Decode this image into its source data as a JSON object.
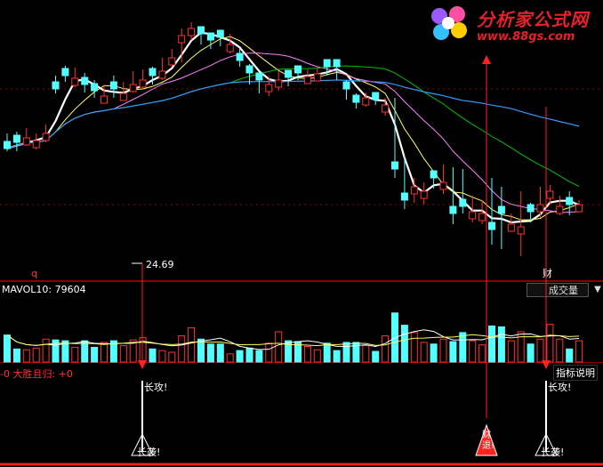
{
  "logo": {
    "title": "分析家公式网",
    "url": "www.88gs.com"
  },
  "price_panel": {
    "low_marker_label": "24.69",
    "left_marker": "q",
    "right_marker": "财"
  },
  "volume_panel": {
    "indicator_label": "MAVOL10: 79604",
    "dropdown_value": "成交量"
  },
  "signal_panel": {
    "formula_label": "-0  大胜且归: +0",
    "help_button": "指标说明",
    "signal_labels": [
      "长攻!",
      "长袭!",
      "长攻!",
      "长袭!"
    ],
    "small_signal": "财\n退!"
  },
  "colors": {
    "up": "#ff3232",
    "down": "#54ffff",
    "ma_white": "#ffffff",
    "ma_yellow": "#ffff66",
    "ma_pink": "#ff80ff",
    "ma_green": "#00c000",
    "ma_blue": "#3399ff",
    "signal_red": "#ff2020",
    "grid": "#8b0000"
  },
  "chart_data": {
    "type": "candlestick",
    "candles": [
      [
        0,
        133,
        130,
        150
      ],
      [
        0,
        140,
        130,
        152
      ],
      [
        1,
        145,
        136,
        156
      ],
      [
        1,
        142,
        132,
        150
      ],
      [
        1,
        150,
        140,
        160
      ],
      [
        0,
        200,
        195,
        215
      ],
      [
        0,
        215,
        208,
        226
      ],
      [
        1,
        212,
        202,
        224
      ],
      [
        0,
        205,
        196,
        218
      ],
      [
        0,
        198,
        190,
        210
      ],
      [
        1,
        192,
        185,
        205
      ],
      [
        0,
        200,
        190,
        215
      ],
      [
        1,
        195,
        188,
        208
      ],
      [
        1,
        205,
        196,
        220
      ],
      [
        1,
        210,
        200,
        222
      ],
      [
        0,
        215,
        205,
        225
      ],
      [
        1,
        220,
        210,
        235
      ],
      [
        1,
        235,
        225,
        245
      ],
      [
        1,
        260,
        230,
        268
      ],
      [
        1,
        268,
        255,
        275
      ],
      [
        0,
        262,
        250,
        270
      ],
      [
        0,
        255,
        245,
        262
      ],
      [
        0,
        258,
        248,
        266
      ],
      [
        1,
        250,
        240,
        262
      ],
      [
        0,
        232,
        225,
        245
      ],
      [
        0,
        218,
        205,
        228
      ],
      [
        0,
        210,
        195,
        218
      ],
      [
        1,
        205,
        192,
        214
      ],
      [
        1,
        210,
        198,
        220
      ],
      [
        0,
        213,
        203,
        220
      ],
      [
        0,
        218,
        210,
        226
      ],
      [
        1,
        214,
        206,
        222
      ],
      [
        1,
        217,
        212,
        224
      ],
      [
        0,
        225,
        215,
        228
      ],
      [
        0,
        225,
        210,
        228
      ],
      [
        0,
        200,
        188,
        210
      ],
      [
        0,
        185,
        178,
        195
      ],
      [
        1,
        190,
        180,
        196
      ],
      [
        0,
        188,
        182,
        196
      ],
      [
        1,
        182,
        170,
        190
      ],
      [
        0,
        110,
        100,
        190
      ],
      [
        0,
        75,
        65,
        125
      ],
      [
        1,
        90,
        72,
        100
      ],
      [
        1,
        85,
        70,
        95
      ],
      [
        0,
        100,
        88,
        108
      ],
      [
        1,
        95,
        82,
        115
      ],
      [
        0,
        60,
        48,
        112
      ],
      [
        0,
        68,
        60,
        110
      ],
      [
        1,
        62,
        50,
        80
      ],
      [
        1,
        60,
        48,
        75
      ],
      [
        0,
        42,
        25,
        100
      ],
      [
        0,
        60,
        20,
        90
      ],
      [
        1,
        48,
        40,
        60
      ],
      [
        1,
        45,
        12,
        85
      ],
      [
        0,
        62,
        50,
        72
      ],
      [
        1,
        70,
        55,
        90
      ],
      [
        1,
        85,
        70,
        92
      ],
      [
        1,
        68,
        58,
        80
      ],
      [
        0,
        70,
        58,
        85
      ],
      [
        1,
        70,
        62,
        75
      ]
    ],
    "volumes": [
      33,
      16,
      15,
      17,
      28,
      27,
      26,
      18,
      26,
      18,
      24,
      26,
      20,
      27,
      30,
      16,
      14,
      12,
      32,
      42,
      28,
      22,
      22,
      10,
      14,
      17,
      14,
      23,
      37,
      26,
      25,
      19,
      15,
      23,
      14,
      24,
      24,
      20,
      13,
      32,
      60,
      45,
      36,
      24,
      22,
      28,
      25,
      36,
      26,
      21,
      44,
      43,
      26,
      37,
      22,
      28,
      46,
      28,
      16,
      26
    ],
    "low_label": "24.69"
  }
}
